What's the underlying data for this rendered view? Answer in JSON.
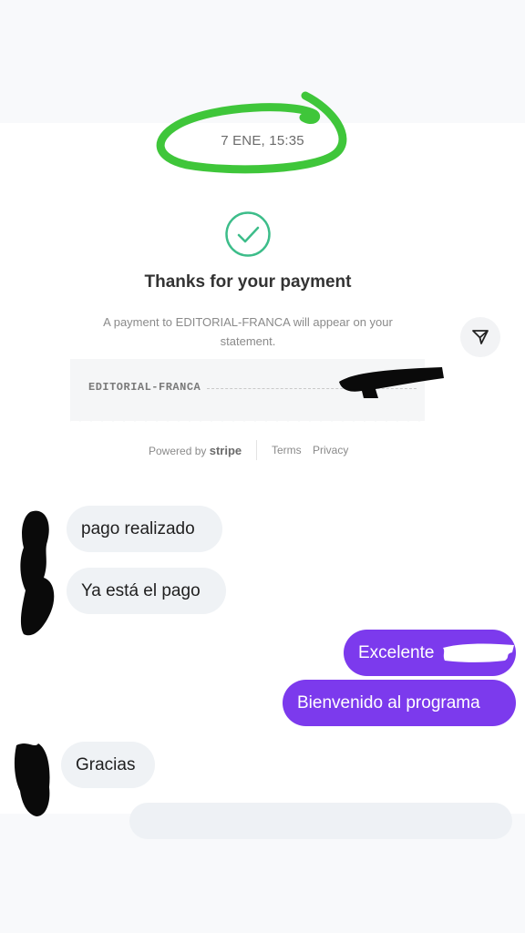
{
  "chat": {
    "timestamp": "7 ENE, 15:35"
  },
  "payment_card": {
    "icon": "check-circle-icon",
    "title": "Thanks for your payment",
    "description": "A payment to EDITORIAL-FRANCA will appear on your statement.",
    "receipt_merchant": "EDITORIAL-FRANCA",
    "powered_by_prefix": "Powered by",
    "powered_by_brand": "stripe",
    "terms_label": "Terms",
    "privacy_label": "Privacy",
    "share_icon": "send-icon"
  },
  "messages": [
    {
      "direction": "incoming",
      "text": "pago realizado"
    },
    {
      "direction": "incoming",
      "text": "Ya está el pago"
    },
    {
      "direction": "outgoing",
      "text": "Excelente"
    },
    {
      "direction": "outgoing",
      "text": "Bienvenido al programa"
    },
    {
      "direction": "incoming",
      "text": "Gracias"
    }
  ],
  "colors": {
    "accent_green": "#3dbd8a",
    "outgoing_bubble": "#7c3aed",
    "incoming_bubble": "#eff2f5",
    "annotation_green": "#3fc63a",
    "redaction": "#000000"
  }
}
